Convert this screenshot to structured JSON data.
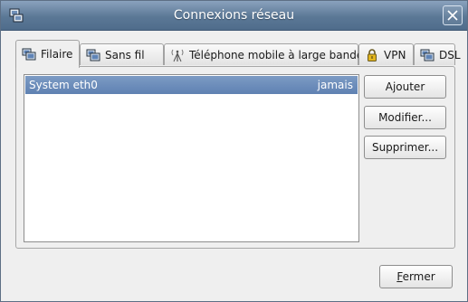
{
  "window": {
    "title": "Connexions réseau"
  },
  "tabs": [
    {
      "label": "Filaire",
      "icon": "wired-network-icon",
      "active": true
    },
    {
      "label": "Sans fil",
      "icon": "wireless-network-icon",
      "active": false
    },
    {
      "label": "Téléphone mobile à large bande",
      "icon": "mobile-broadband-icon",
      "active": false
    },
    {
      "label": "VPN",
      "icon": "lock-icon",
      "active": false
    },
    {
      "label": "DSL",
      "icon": "dsl-network-icon",
      "active": false
    }
  ],
  "connections": [
    {
      "name": "System eth0",
      "last_used": "jamais",
      "selected": true
    }
  ],
  "buttons": {
    "add": "Ajouter",
    "edit": "Modifier...",
    "delete": "Supprimer...",
    "close_mnemonic": "F",
    "close_rest": "ermer"
  },
  "colors": {
    "titlebar": "#5b7896",
    "selection": "#6d8ebb"
  }
}
